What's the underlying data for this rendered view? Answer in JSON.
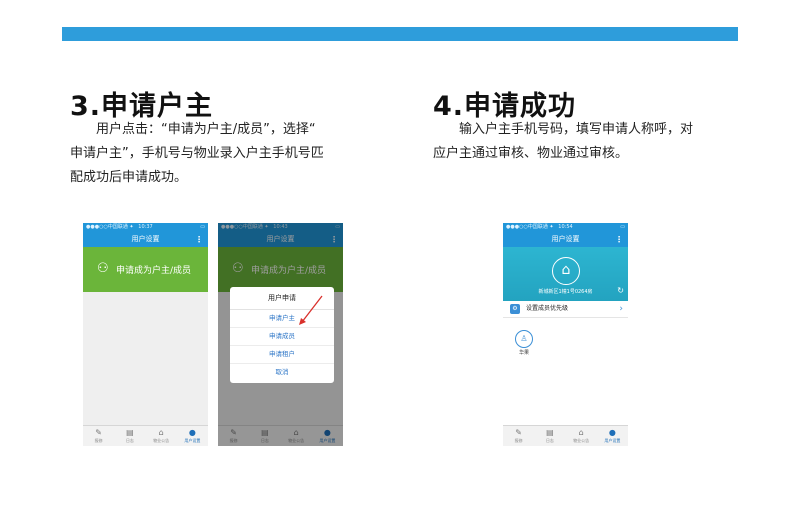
{
  "colors": {
    "accent_bar": "#2e9ddb",
    "nav_blue": "#2196d9",
    "green_banner": "#6bb53a",
    "link_blue": "#2d76c7"
  },
  "section3": {
    "title": "3.申请户主",
    "para_line1": "用户点击：“申请为户主/成员”，选择“",
    "para_line2": "申请户主”，手机号与物业录入户主手机号匹",
    "para_line3": "配成功后申请成功。"
  },
  "section4": {
    "title": "4.申请成功",
    "para_line1": "输入户主手机号码，填写申请人称呼，对",
    "para_line2": "应户主通过审核、物业通过审核。"
  },
  "phone1": {
    "status_left": "●●●○○中国联通 ✦",
    "status_time": "10:37",
    "status_right": "▭",
    "nav_title": "用户设置",
    "banner_text": "申请成为户主/成员",
    "tabs": [
      {
        "icon": "pen-icon",
        "label": "报修"
      },
      {
        "icon": "calendar-icon",
        "label": "日志"
      },
      {
        "icon": "home-icon",
        "label": "物业公告"
      },
      {
        "icon": "person-icon",
        "label": "用户设置"
      }
    ]
  },
  "phone2": {
    "status_left": "●●●○○中国联通 ✦",
    "status_time": "10:43",
    "status_right": "▭",
    "nav_title": "用户设置",
    "banner_text": "申请成为户主/成员",
    "dialog": {
      "title": "用户申请",
      "options": [
        "申请户主",
        "申请成员",
        "申请租户",
        "取消"
      ]
    },
    "tabs": [
      {
        "icon": "pen-icon",
        "label": "报修"
      },
      {
        "icon": "calendar-icon",
        "label": "日志"
      },
      {
        "icon": "home-icon",
        "label": "物业公告"
      },
      {
        "icon": "person-icon",
        "label": "用户设置"
      }
    ]
  },
  "phone3": {
    "status_left": "●●●○○中国联通 ✦",
    "status_time": "10:54",
    "status_right": "▭",
    "nav_title": "用户设置",
    "address": "新城新区1幢1号0264房",
    "row_label": "设置成员优先级",
    "member_name": "华果",
    "tabs": [
      {
        "icon": "pen-icon",
        "label": "报修"
      },
      {
        "icon": "calendar-icon",
        "label": "日志"
      },
      {
        "icon": "home-icon",
        "label": "物业公告"
      },
      {
        "icon": "person-icon",
        "label": "用户设置"
      }
    ]
  }
}
